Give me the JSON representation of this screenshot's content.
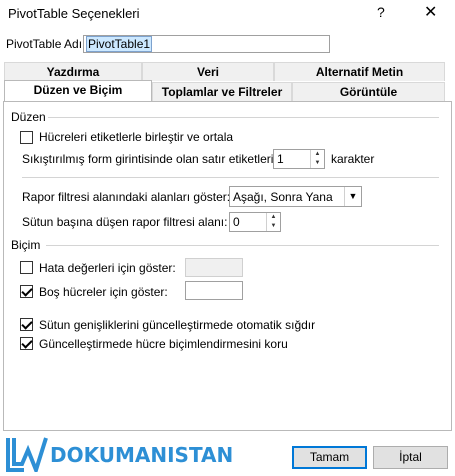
{
  "window": {
    "title": "PivotTable Seçenekleri",
    "help": "?",
    "close": "✕"
  },
  "name_row": {
    "label": "PivotTable Adı:",
    "value": "PivotTable1"
  },
  "tabs_back": [
    "Yazdırma",
    "Veri",
    "Alternatif Metin"
  ],
  "tabs_front": [
    "Düzen ve Biçim",
    "Toplamlar ve Filtreler",
    "Görüntüle"
  ],
  "layout": {
    "section": "Düzen",
    "merge_label": "Hücreleri etiketlerle birleştir ve ortala",
    "merge_checked": false,
    "indent_label": "Sıkıştırılmış form girintisinde olan satır etiketleri:",
    "indent_value": "1",
    "indent_unit": "karakter",
    "filter_area_label": "Rapor filtresi alanındaki alanları göster:",
    "filter_area_value": "Aşağı, Sonra Yana",
    "filter_cols_label": "Sütun başına düşen rapor filtresi alanı:",
    "filter_cols_value": "0"
  },
  "format": {
    "section": "Biçim",
    "error_label": "Hata değerleri için göster:",
    "error_checked": false,
    "error_value": "",
    "empty_label": "Boş hücreler için göster:",
    "empty_checked": true,
    "empty_value": "",
    "autofit_label": "Sütun genişliklerini güncelleştirmede otomatik sığdır",
    "autofit_checked": true,
    "preserve_label": "Güncelleştirmede hücre biçimlendirmesini koru",
    "preserve_checked": true
  },
  "buttons": {
    "ok": "Tamam",
    "cancel": "İptal"
  },
  "logo": {
    "text": "DOKUMANISTAN"
  }
}
